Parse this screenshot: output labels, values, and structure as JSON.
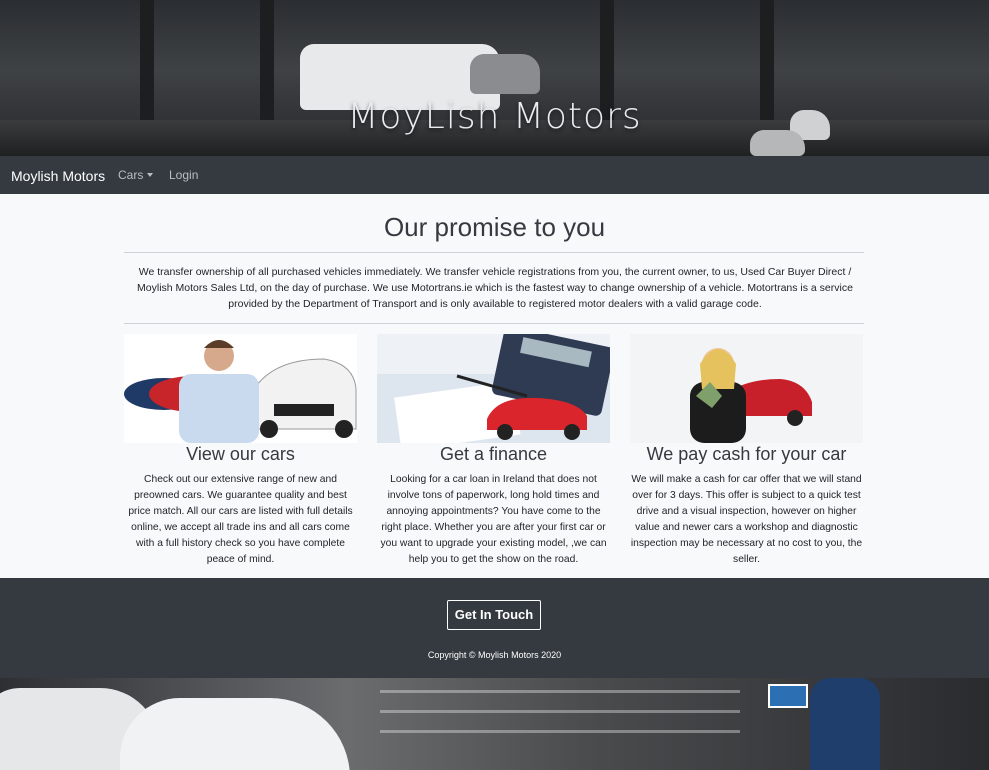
{
  "hero": {
    "title": "MoyLish Motors"
  },
  "navbar": {
    "brand": "Moylish Motors",
    "items": [
      {
        "label": "Cars"
      },
      {
        "label": "Login"
      }
    ]
  },
  "promise": {
    "title": "Our promise to you",
    "text": "We transfer ownership of all purchased vehicles immediately. We transfer vehicle registrations from you, the current owner, to us, Used Car Buyer Direct / Moylish Motors Sales Ltd, on the day of purchase. We use Motortrans.ie which is the fastest way to change ownership of a vehicle. Motortrans is a service provided by the Department of Transport and is only available to registered motor dealers with a valid garage code."
  },
  "features": [
    {
      "title": "View our cars",
      "text": "Check out our extensive range of new and preowned cars. We guarantee quality and best price match. All our cars are listed with full details online, we accept all trade ins and all cars come with a full history check so you have complete peace of mind."
    },
    {
      "title": "Get a finance",
      "text": "Looking for a car loan in Ireland that does not involve tons of paperwork, long hold times and annoying appointments? You have come to the right place. Whether you are after your first car or you want to upgrade your existing model, ,we can help you to get the show on the road."
    },
    {
      "title": "We pay cash for your car",
      "text": "We will make a cash for car offer that we will stand over for 3 days. This offer is subject to a quick test drive and a visual inspection, however on higher value and newer cars a workshop and diagnostic inspection may be necessary at no cost to you, the seller."
    }
  ],
  "footer": {
    "button": "Get In Touch",
    "copyright": "Copyright © Moylish Motors 2020"
  },
  "colors": {
    "dark": "#343a40",
    "light": "#f8f9fa",
    "accent_red": "#d9252b"
  }
}
